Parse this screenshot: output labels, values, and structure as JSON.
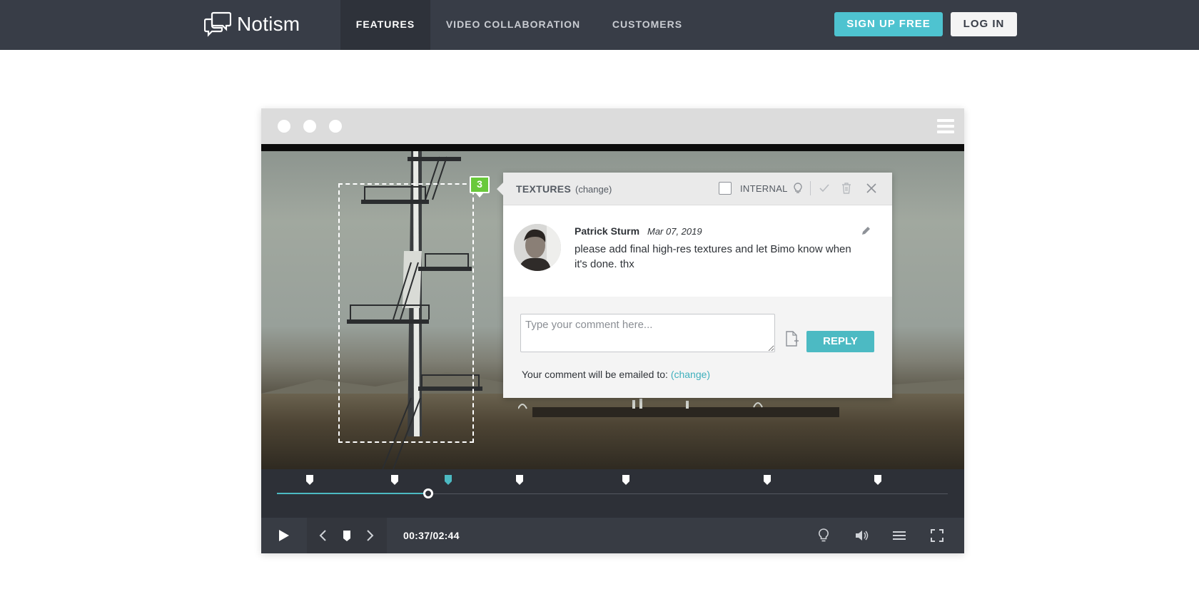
{
  "brand": {
    "name": "Notism",
    "icon": "chat-bubbles-icon"
  },
  "nav": {
    "links": [
      {
        "label": "FEATURES",
        "active": true
      },
      {
        "label": "VIDEO COLLABORATION",
        "active": false
      },
      {
        "label": "CUSTOMERS",
        "active": false
      }
    ],
    "signup_label": "SIGN UP FREE",
    "login_label": "LOG IN"
  },
  "player": {
    "annotation_badge": "3",
    "popup": {
      "title": "TEXTURES",
      "title_change": "(change)",
      "internal_label": "INTERNAL",
      "internal_checked": false,
      "icons": [
        "lightbulb-icon",
        "check-icon",
        "trash-icon",
        "close-icon"
      ],
      "comment": {
        "author": "Patrick Sturm",
        "date": "Mar 07, 2019",
        "text": "please add final high-res textures and let Bimo know when it's done. thx"
      },
      "reply": {
        "placeholder": "Type your comment here...",
        "button_label": "REPLY",
        "email_note": "Your comment will be emailed to:",
        "email_change": "(change)"
      }
    },
    "timeline": {
      "progress_fraction": 0.2256,
      "marker_count": 7,
      "active_marker_index": 2
    },
    "controls": {
      "timecode": "00:37/02:44",
      "icons": [
        "play-icon",
        "prev-icon",
        "marker-icon",
        "next-icon",
        "lightbulb-icon",
        "volume-icon",
        "list-icon",
        "fullscreen-icon"
      ]
    }
  },
  "colors": {
    "nav_bg": "#383d47",
    "accent": "#4ec3d0",
    "reply_button": "#4cbac3",
    "badge": "#69c93b"
  }
}
